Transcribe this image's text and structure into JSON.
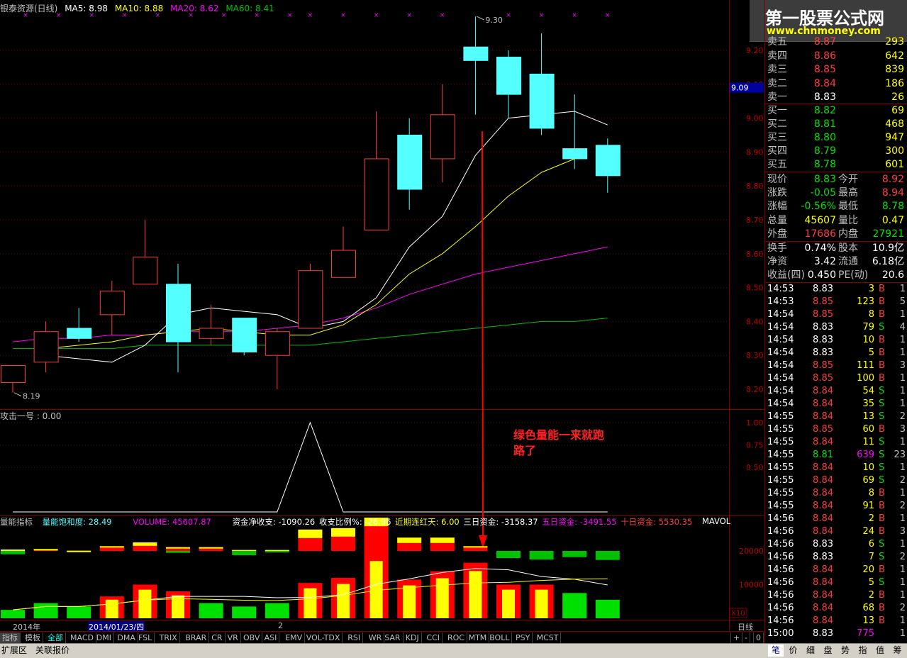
{
  "header": {
    "title": "银泰资源(日线)",
    "ma5": "MA5: 8.98",
    "ma10": "MA10: 8.88",
    "ma20": "MA20: 8.62",
    "ma60": "MA60: 8.41",
    "high_label": "9.30",
    "low_label": "8.19",
    "current_price_tag": "9.09",
    "colors": {
      "ma5": "#ffffff",
      "ma10": "#ffff00",
      "ma20": "#ff00ff",
      "ma60": "#00c000",
      "up": "#ff3c3c",
      "down": "#54ffff"
    }
  },
  "price_axis": [
    "9.20",
    "9.10",
    "9.00",
    "8.90",
    "8.80",
    "8.70",
    "8.60",
    "8.50",
    "8.40",
    "8.30",
    "8.20"
  ],
  "indicator1": {
    "label": "攻击一号 : 0.00",
    "axis": [
      "1.00",
      "0.75",
      "0.50"
    ],
    "annotation_line1": "绿色量能一来就跑",
    "annotation_line2": "路了"
  },
  "indicator2": {
    "name": "量能指标",
    "saturation": "量能饱和度: 28.49",
    "volume": "VOLUME: 45607.87",
    "net": "资金净收支: -1090.26",
    "ratio": "收支比例%: -26.96",
    "red_days": "近期连红天: 6.00",
    "three_day": "三日资金: -3158.37",
    "five_day": "五日资金: -3491.55",
    "ten_day": "十日资金: 5530.35",
    "mavol": "MAVOL",
    "axis": [
      "20000",
      "10000"
    ],
    "x10": "X10"
  },
  "time_axis": {
    "year": "2014年",
    "date": "2014/01/23/四",
    "mark": "2",
    "period": "日线"
  },
  "chart_data": {
    "type": "candlestick",
    "title": "银泰资源(日线)",
    "ylim": [
      8.15,
      9.35
    ],
    "candles": [
      {
        "o": 8.22,
        "h": 8.27,
        "l": 8.19,
        "c": 8.27
      },
      {
        "o": 8.28,
        "h": 8.4,
        "l": 8.25,
        "c": 8.37
      },
      {
        "o": 8.38,
        "h": 8.44,
        "l": 8.34,
        "c": 8.35
      },
      {
        "o": 8.42,
        "h": 8.52,
        "l": 8.36,
        "c": 8.49
      },
      {
        "o": 8.51,
        "h": 8.7,
        "l": 8.51,
        "c": 8.59
      },
      {
        "o": 8.51,
        "h": 8.57,
        "l": 8.25,
        "c": 8.34
      },
      {
        "o": 8.35,
        "h": 8.45,
        "l": 8.33,
        "c": 8.38
      },
      {
        "o": 8.41,
        "h": 8.41,
        "l": 8.3,
        "c": 8.31
      },
      {
        "o": 8.3,
        "h": 8.38,
        "l": 8.2,
        "c": 8.37
      },
      {
        "o": 8.38,
        "h": 8.57,
        "l": 8.38,
        "c": 8.55
      },
      {
        "o": 8.53,
        "h": 8.68,
        "l": 8.53,
        "c": 8.61
      },
      {
        "o": 8.67,
        "h": 9.02,
        "l": 8.67,
        "c": 8.88
      },
      {
        "o": 8.95,
        "h": 9.0,
        "l": 8.73,
        "c": 8.79
      },
      {
        "o": 8.88,
        "h": 9.1,
        "l": 8.81,
        "c": 9.01
      },
      {
        "o": 9.21,
        "h": 9.3,
        "l": 9.01,
        "c": 9.17
      },
      {
        "o": 9.18,
        "h": 9.2,
        "l": 9.0,
        "c": 9.07
      },
      {
        "o": 9.13,
        "h": 9.25,
        "l": 8.95,
        "c": 8.97
      },
      {
        "o": 8.91,
        "h": 9.07,
        "l": 8.85,
        "c": 8.88
      },
      {
        "o": 8.92,
        "h": 8.94,
        "l": 8.78,
        "c": 8.83
      }
    ],
    "ma5": [
      8.3,
      8.29,
      8.28,
      8.33,
      8.42,
      8.44,
      8.43,
      8.42,
      8.38,
      8.4,
      8.47,
      8.62,
      8.71,
      8.89,
      9.0,
      9.01,
      9.02,
      8.98
    ],
    "ma10": [
      8.32,
      8.33,
      8.34,
      8.36,
      8.37,
      8.38,
      8.37,
      8.36,
      8.36,
      8.39,
      8.45,
      8.54,
      8.6,
      8.68,
      8.77,
      8.84,
      8.88
    ],
    "ma20": [
      8.34,
      8.35,
      8.35,
      8.36,
      8.36,
      8.37,
      8.37,
      8.37,
      8.38,
      8.39,
      8.41,
      8.44,
      8.48,
      8.51,
      8.54,
      8.56,
      8.58,
      8.6,
      8.62
    ],
    "ma60": [
      8.32,
      8.32,
      8.32,
      8.32,
      8.33,
      8.33,
      8.33,
      8.33,
      8.33,
      8.33,
      8.34,
      8.35,
      8.36,
      8.37,
      8.38,
      8.39,
      8.4,
      8.4,
      8.41
    ],
    "attack_signal": [
      0,
      0,
      0,
      0,
      0,
      0,
      0,
      0,
      0,
      1,
      0,
      0,
      0,
      0,
      0,
      0,
      0,
      0,
      0
    ],
    "money_flow_up": [
      300,
      400,
      50,
      1000,
      1800,
      800,
      800,
      200,
      200,
      4500,
      4800,
      7000,
      2800,
      2800,
      1000,
      0,
      0,
      0,
      0
    ],
    "money_flow_down": [
      -700,
      0,
      0,
      0,
      0,
      -400,
      0,
      -900,
      -300,
      0,
      0,
      0,
      0,
      0,
      0,
      -1500,
      -1800,
      -1300,
      -1900
    ],
    "volume": [
      2500,
      4500,
      3500,
      6500,
      10000,
      8000,
      4500,
      3500,
      4500,
      10500,
      12000,
      20000,
      11500,
      14000,
      16500,
      10000,
      10000,
      7500,
      5500
    ],
    "volume_color": [
      "g",
      "g",
      "g",
      "r",
      "r",
      "r",
      "g",
      "g",
      "g",
      "r",
      "r",
      "r",
      "r",
      "r",
      "r",
      "r",
      "r",
      "g",
      "g"
    ]
  },
  "quote": {
    "asks": [
      {
        "label": "卖五",
        "price": "8.87",
        "vol": "293"
      },
      {
        "label": "卖四",
        "price": "8.86",
        "vol": "642"
      },
      {
        "label": "卖三",
        "price": "8.85",
        "vol": "839"
      },
      {
        "label": "卖二",
        "price": "8.84",
        "vol": "186"
      },
      {
        "label": "卖一",
        "price": "8.83",
        "vol": "26"
      }
    ],
    "bids": [
      {
        "label": "买一",
        "price": "8.82",
        "vol": "69"
      },
      {
        "label": "买二",
        "price": "8.81",
        "vol": "468"
      },
      {
        "label": "买三",
        "price": "8.80",
        "vol": "947"
      },
      {
        "label": "买四",
        "price": "8.79",
        "vol": "300"
      },
      {
        "label": "买五",
        "price": "8.78",
        "vol": "601"
      }
    ],
    "stats": [
      {
        "l1": "现价",
        "v1": "8.83",
        "l2": "今开",
        "v2": "8.92"
      },
      {
        "l1": "涨跌",
        "v1": "-0.05",
        "l2": "最高",
        "v2": "8.94"
      },
      {
        "l1": "涨幅",
        "v1": "-0.56%",
        "l2": "最低",
        "v2": "8.78"
      },
      {
        "l1": "总量",
        "v1": "45607",
        "l2": "量比",
        "v2": "0.47"
      },
      {
        "l1": "外盘",
        "v1": "17686",
        "l2": "内盘",
        "v2": "27921"
      }
    ],
    "info": [
      {
        "l1": "换手",
        "v1": "0.74%",
        "l2": "股本",
        "v2": "10.9亿"
      },
      {
        "l1": "净资",
        "v1": "3.42",
        "l2": "流通",
        "v2": "6.18亿"
      },
      {
        "l1": "收益(四)",
        "v1": "0.450",
        "l2": "PE(动)",
        "v2": "20.6"
      }
    ],
    "ticks": [
      {
        "t": "14:53",
        "p": "8.83",
        "v": "3",
        "s": "B",
        "n": "1"
      },
      {
        "t": "14:53",
        "p": "8.85",
        "v": "123",
        "s": "B",
        "n": "5"
      },
      {
        "t": "14:54",
        "p": "8.85",
        "v": "8",
        "s": "B",
        "n": "1"
      },
      {
        "t": "14:54",
        "p": "8.83",
        "v": "79",
        "s": "S",
        "n": "4"
      },
      {
        "t": "14:54",
        "p": "8.83",
        "v": "10",
        "s": "B",
        "n": "1"
      },
      {
        "t": "14:54",
        "p": "8.83",
        "v": "5",
        "s": "B",
        "n": "1"
      },
      {
        "t": "14:54",
        "p": "8.85",
        "v": "111",
        "s": "B",
        "n": "3"
      },
      {
        "t": "14:54",
        "p": "8.85",
        "v": "100",
        "s": "B",
        "n": "1"
      },
      {
        "t": "14:54",
        "p": "8.84",
        "v": "54",
        "s": "S",
        "n": "1"
      },
      {
        "t": "14:54",
        "p": "8.84",
        "v": "35",
        "s": "S",
        "n": "1"
      },
      {
        "t": "14:55",
        "p": "8.84",
        "v": "13",
        "s": "S",
        "n": "2"
      },
      {
        "t": "14:55",
        "p": "8.85",
        "v": "60",
        "s": "B",
        "n": "3"
      },
      {
        "t": "14:55",
        "p": "8.84",
        "v": "11",
        "s": "S",
        "n": "1"
      },
      {
        "t": "14:55",
        "p": "8.81",
        "v": "639",
        "s": "S",
        "n": "23"
      },
      {
        "t": "14:55",
        "p": "8.84",
        "v": "10",
        "s": "S",
        "n": "1"
      },
      {
        "t": "14:55",
        "p": "8.84",
        "v": "69",
        "s": "S",
        "n": "2"
      },
      {
        "t": "14:55",
        "p": "8.84",
        "v": "8",
        "s": "B",
        "n": "1"
      },
      {
        "t": "14:55",
        "p": "8.84",
        "v": "91",
        "s": "B",
        "n": "2"
      },
      {
        "t": "14:56",
        "p": "8.84",
        "v": "2",
        "s": "B",
        "n": "1"
      },
      {
        "t": "14:56",
        "p": "8.84",
        "v": "24",
        "s": "B",
        "n": "3"
      },
      {
        "t": "14:56",
        "p": "8.83",
        "v": "6",
        "s": "S",
        "n": "1"
      },
      {
        "t": "14:56",
        "p": "8.83",
        "v": "7",
        "s": "S",
        "n": "2"
      },
      {
        "t": "14:56",
        "p": "8.84",
        "v": "20",
        "s": "B",
        "n": "1"
      },
      {
        "t": "14:56",
        "p": "8.84",
        "v": "5",
        "s": "S",
        "n": "1"
      },
      {
        "t": "14:56",
        "p": "8.84",
        "v": "2",
        "s": "B",
        "n": "1"
      },
      {
        "t": "14:56",
        "p": "8.84",
        "v": "68",
        "s": "B",
        "n": "2"
      },
      {
        "t": "14:56",
        "p": "8.84",
        "v": "13",
        "s": "B",
        "n": "1"
      },
      {
        "t": "15:00",
        "p": "8.83",
        "v": "775",
        "s": "",
        "n": "1"
      }
    ]
  },
  "logo": {
    "title": "第一股票公式网",
    "url": "www.chnmoney.com"
  },
  "indicator_tabs": [
    "指标",
    "模板",
    "全部",
    "MACD",
    "DMI",
    "DMA",
    "FSL",
    "TRIX",
    "BRAR",
    "CR",
    "VR",
    "OBV",
    "ASI",
    "EMV",
    "VOL-TDX",
    "RSI",
    "WR",
    "SAR",
    "KDJ",
    "CCI",
    "ROC",
    "MTM",
    "BOLL",
    "PSY",
    "MCST"
  ],
  "bottom_left_tabs": [
    "扩展区",
    "关联报价"
  ],
  "bottom_right_tabs": [
    "笔",
    "价",
    "细",
    "盘",
    "势",
    "指",
    "值",
    "筹"
  ],
  "nav_controls": [
    "+",
    "-",
    "0"
  ]
}
